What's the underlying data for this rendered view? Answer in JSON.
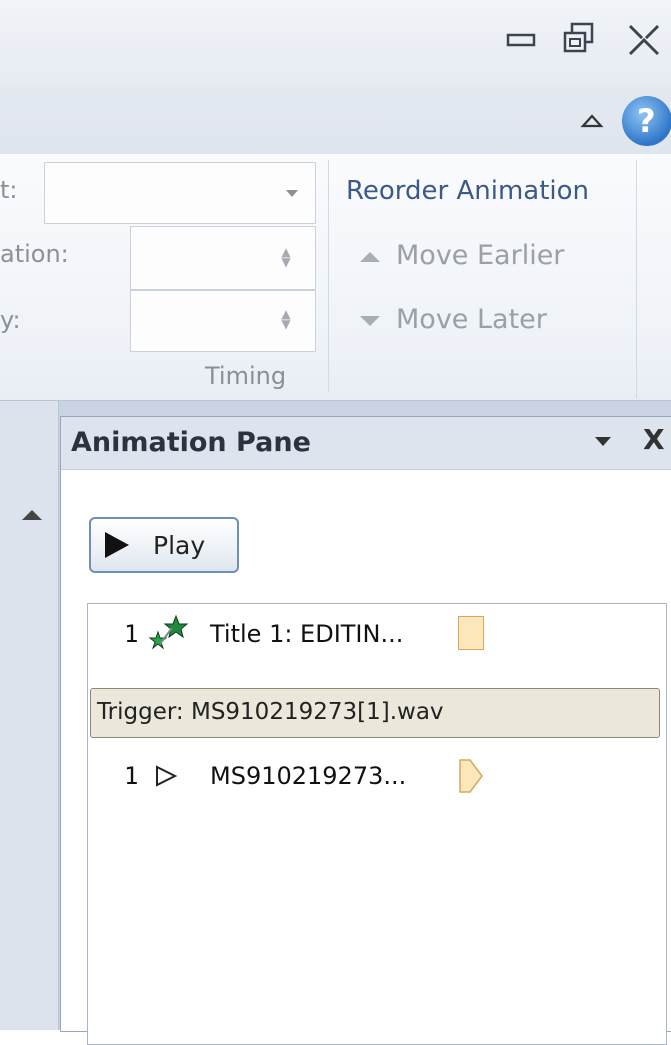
{
  "ribbon": {
    "timing": {
      "start_label": "t:",
      "start_value": "",
      "duration_label": "ation:",
      "duration_value": "",
      "delay_label": "y:",
      "delay_value": "",
      "group_label": "Timing"
    },
    "reorder": {
      "title": "Reorder Animation",
      "move_earlier": "Move Earlier",
      "move_later": "Move Later"
    }
  },
  "animation_pane": {
    "title": "Animation Pane",
    "play_label": "Play",
    "items": [
      {
        "number": "1",
        "icon": "emphasis-stars-icon",
        "text": "Title 1: EDITIN..."
      },
      {
        "number": "1",
        "icon": "media-play-icon",
        "text": "MS910219273..."
      }
    ],
    "trigger_text": "Trigger: MS910219273[1].wav"
  },
  "colors": {
    "accent": "#3c5a86",
    "timing_bar": "#fbe7ba",
    "trigger_bg": "#ebe7db"
  }
}
